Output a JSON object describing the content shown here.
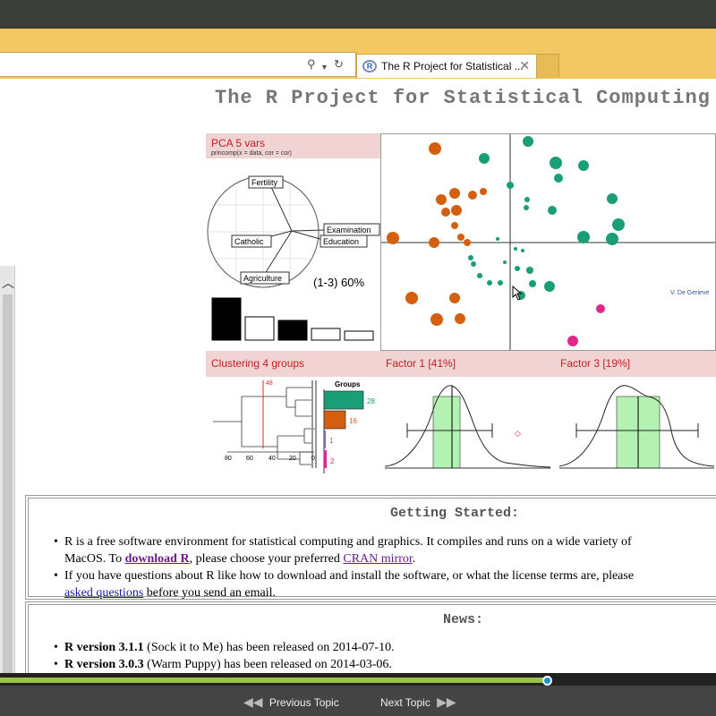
{
  "browser": {
    "tab_title": "The R Project for Statistical ...",
    "tab_close": "✕",
    "search_icon": "search-icon",
    "refresh_icon": "refresh-icon"
  },
  "page": {
    "title": "The R Project for Statistical Computing",
    "figure": {
      "pca_label": "PCA  5 vars",
      "pca_sub": "princomp(x = data, cor = cor)",
      "vars": [
        "Fertility",
        "Examination",
        "Catholic",
        "Education",
        "Agriculture"
      ],
      "pca_pct": "(1-3) 60%",
      "credit": "V. De Gerieve",
      "cluster_label": "Clustering  4 groups",
      "groups_title": "Groups",
      "group_counts": [
        "28",
        "16",
        "1",
        "2"
      ],
      "axis_ticks": [
        "80",
        "60",
        "40",
        "20",
        "0"
      ],
      "factor1_label": "Factor 1 [41%]",
      "factor3_label": "Factor 3 [19%]",
      "cut_label": "48"
    },
    "getting_started": {
      "heading": "Getting Started:",
      "b1_a": "R is a free software environment for statistical computing and graphics. It compiles and runs on a wide variety of",
      "b1_b": "MacOS. To ",
      "b1_link1": "download R",
      "b1_c": ", please choose your preferred ",
      "b1_link2": "CRAN mirror",
      "b1_d": ".",
      "b2_a": "If you have questions about R like how to download and install the software, or what the license terms are, please",
      "b2_link": "asked questions",
      "b2_b": " before you send an email."
    },
    "news": {
      "heading": "News:",
      "n1_bold": "R version 3.1.1",
      "n1_rest": " (Sock it to Me) has been released on 2014-07-10.",
      "n2_bold": "R version 3.0.3",
      "n2_rest": " (Warm Puppy) has been released on 2014-03-06."
    }
  },
  "player": {
    "progress": 0.765,
    "prev_label": "Previous Topic",
    "next_label": "Next Topic"
  },
  "colors": {
    "green": "#1a9e77",
    "orange": "#d45f0e",
    "magenta": "#e0288a",
    "accent": "#f3c863"
  }
}
